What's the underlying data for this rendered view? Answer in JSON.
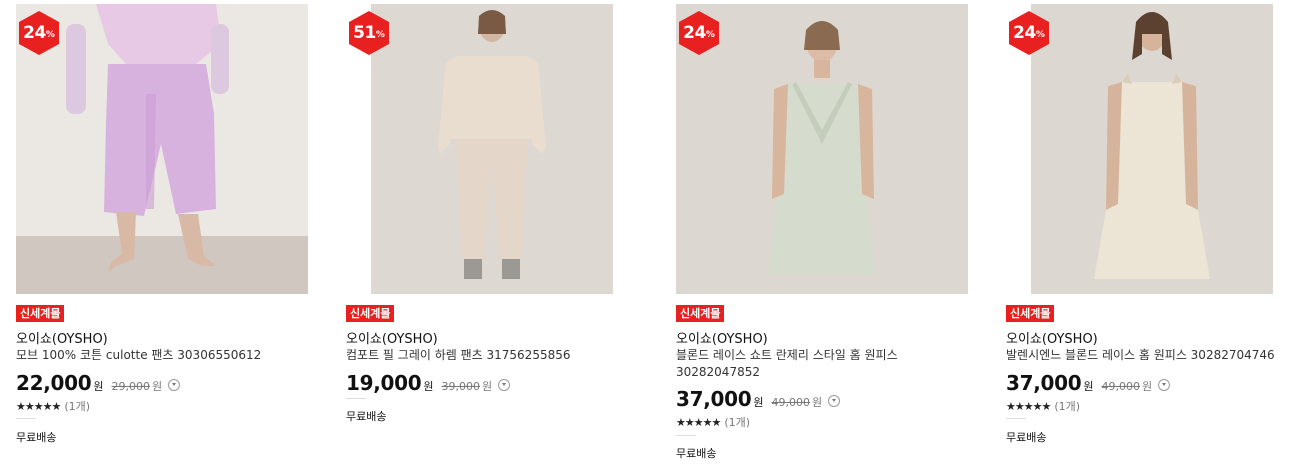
{
  "products": [
    {
      "discount": "24",
      "discount_unit": "%",
      "tag": "신세계몰",
      "brand": "오이쇼(OYSHO)",
      "title": "모브 100% 코튼 culotte 팬츠 30306550612",
      "price": "22,000",
      "price_unit": "원",
      "original_price": "29,000",
      "original_unit": "원",
      "stars": "★★★★★",
      "review_count": "(1개)",
      "shipping": "무료배송",
      "image": "lilac-pajama-pants-photo"
    },
    {
      "discount": "51",
      "discount_unit": "%",
      "tag": "신세계몰",
      "brand": "오이쇼(OYSHO)",
      "title": "컴포트 필 그레이 하렘 팬츠 31756255856",
      "price": "19,000",
      "price_unit": "원",
      "original_price": "39,000",
      "original_unit": "원",
      "shipping": "무료배송",
      "image": "beige-loungewear-set-photo"
    },
    {
      "discount": "24",
      "discount_unit": "%",
      "tag": "신세계몰",
      "brand": "오이쇼(OYSHO)",
      "title": "블론드 레이스 쇼트 란제리 스타일 홈 원피스 30282047852",
      "price": "37,000",
      "price_unit": "원",
      "original_price": "49,000",
      "original_unit": "원",
      "stars": "★★★★★",
      "review_count": "(1개)",
      "shipping": "무료배송",
      "image": "mint-lace-slip-dress-photo"
    },
    {
      "discount": "24",
      "discount_unit": "%",
      "tag": "신세계몰",
      "brand": "오이쇼(OYSHO)",
      "title": "발렌시엔느 블론드 레이스 홈 원피스 30282704746",
      "price": "37,000",
      "price_unit": "원",
      "original_price": "49,000",
      "original_unit": "원",
      "stars": "★★★★★",
      "review_count": "(1개)",
      "shipping": "무료배송",
      "image": "cream-slip-dress-photo"
    }
  ],
  "colors": {
    "badge": "#e8201f",
    "tag": "#e8201f"
  }
}
